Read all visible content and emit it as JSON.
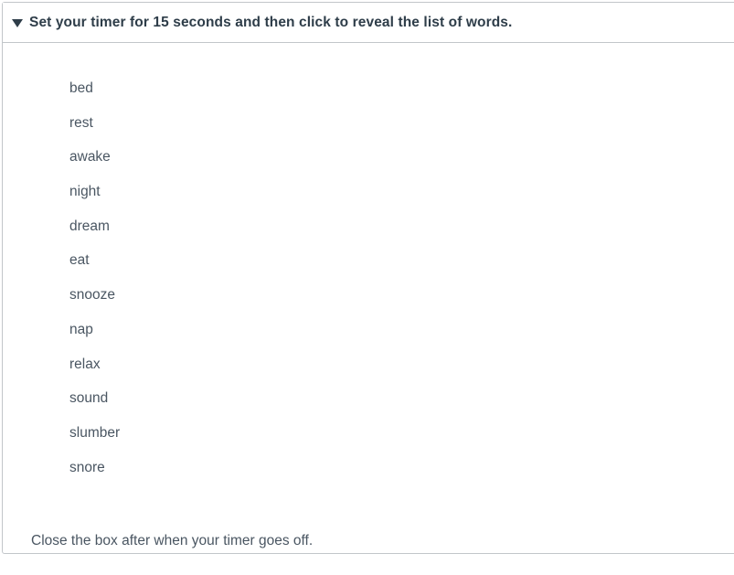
{
  "panel": {
    "header": {
      "disclosure_icon": "triangle-down-icon",
      "title": "Set your timer for 15 seconds and then click to reveal the list of words.",
      "expanded": true
    },
    "words": [
      "bed",
      "rest",
      "awake",
      "night",
      "dream",
      "eat",
      "snooze",
      "nap",
      "relax",
      "sound",
      "slumber",
      "snore"
    ],
    "footer_note": "Close the box after when your timer goes off."
  },
  "colors": {
    "border": "#c2c6ca",
    "header_text": "#2e3d49",
    "body_text": "#4a5662",
    "background": "#ffffff"
  }
}
